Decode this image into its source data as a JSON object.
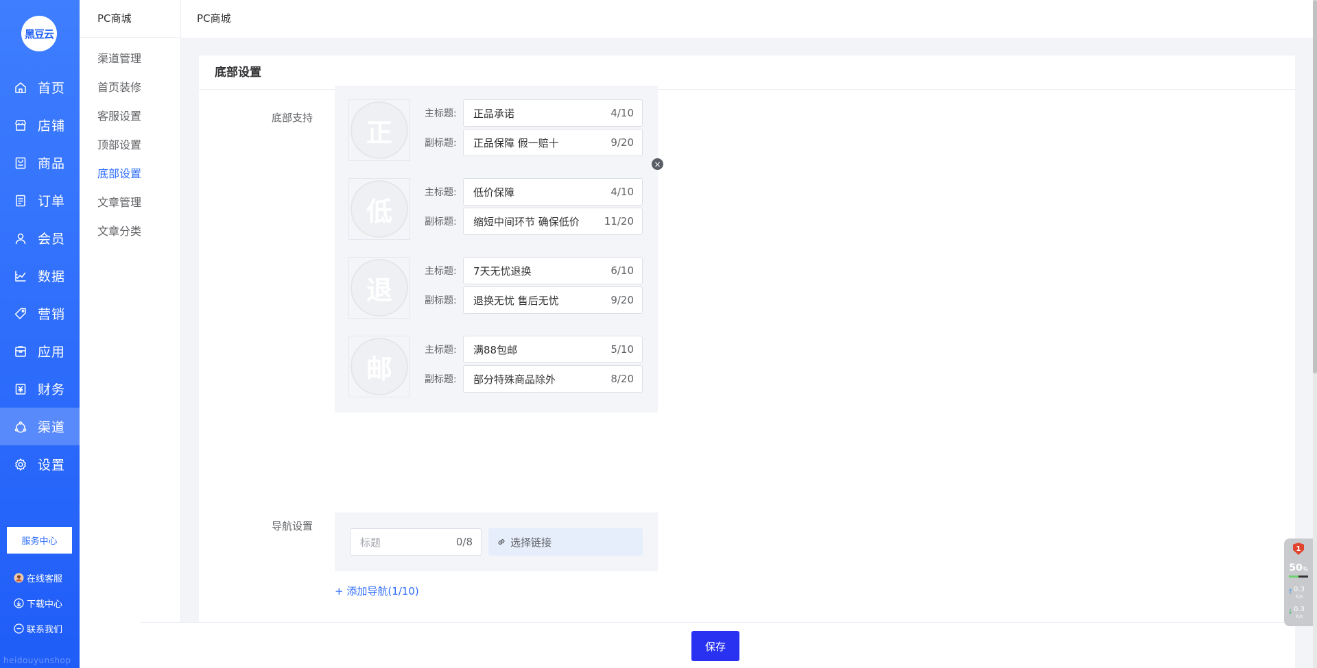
{
  "brand": {
    "logo_text": "黑豆云",
    "watermark": "heidouyunshop"
  },
  "nav": {
    "items": [
      {
        "label": "首页",
        "icon": "home-icon"
      },
      {
        "label": "店铺",
        "icon": "store-icon"
      },
      {
        "label": "商品",
        "icon": "goods-icon"
      },
      {
        "label": "订单",
        "icon": "order-icon"
      },
      {
        "label": "会员",
        "icon": "member-icon"
      },
      {
        "label": "数据",
        "icon": "data-icon"
      },
      {
        "label": "营销",
        "icon": "tag-icon"
      },
      {
        "label": "应用",
        "icon": "app-icon"
      },
      {
        "label": "财务",
        "icon": "finance-icon"
      },
      {
        "label": "渠道",
        "icon": "channel-icon"
      },
      {
        "label": "设置",
        "icon": "gear-icon"
      }
    ],
    "active_index": 9
  },
  "side_footer": {
    "service_center": "服务中心",
    "online_service": "在线客服",
    "download_center": "下载中心",
    "contact_us": "联系我们"
  },
  "subnav": {
    "title": "PC商城",
    "items": [
      "渠道管理",
      "首页装修",
      "客服设置",
      "顶部设置",
      "底部设置",
      "文章管理",
      "文章分类"
    ],
    "active_index": 4
  },
  "breadcrumb": "PC商城",
  "card_title": "底部设置",
  "support": {
    "label": "底部支持",
    "main_title_label": "主标题:",
    "sub_title_label": "副标题:",
    "items": [
      {
        "icon_char": "正",
        "title": "正品承诺",
        "title_count": "4/10",
        "subtitle": "正品保障 假一赔十",
        "subtitle_count": "9/20"
      },
      {
        "icon_char": "低",
        "title": "低价保障",
        "title_count": "4/10",
        "subtitle": "缩短中间环节 确保低价",
        "subtitle_count": "11/20"
      },
      {
        "icon_char": "退",
        "title": "7天无忧退换",
        "title_count": "6/10",
        "subtitle": "退换无忧 售后无忧",
        "subtitle_count": "9/20"
      },
      {
        "icon_char": "邮",
        "title": "满88包邮",
        "title_count": "5/10",
        "subtitle": "部分特殊商品除外",
        "subtitle_count": "8/20"
      }
    ]
  },
  "navigation": {
    "label": "导航设置",
    "title_placeholder": "标题",
    "title_count": "0/8",
    "link_button": "选择链接",
    "add_button": "+ 添加导航(1/10)"
  },
  "save_button": "保存",
  "speed_widget": {
    "badge": "1",
    "percent": "50",
    "percent_unit": "%",
    "usage_fraction": 0.5,
    "up_value": "0.3",
    "down_value": "0.3",
    "unit": "K/s"
  }
}
